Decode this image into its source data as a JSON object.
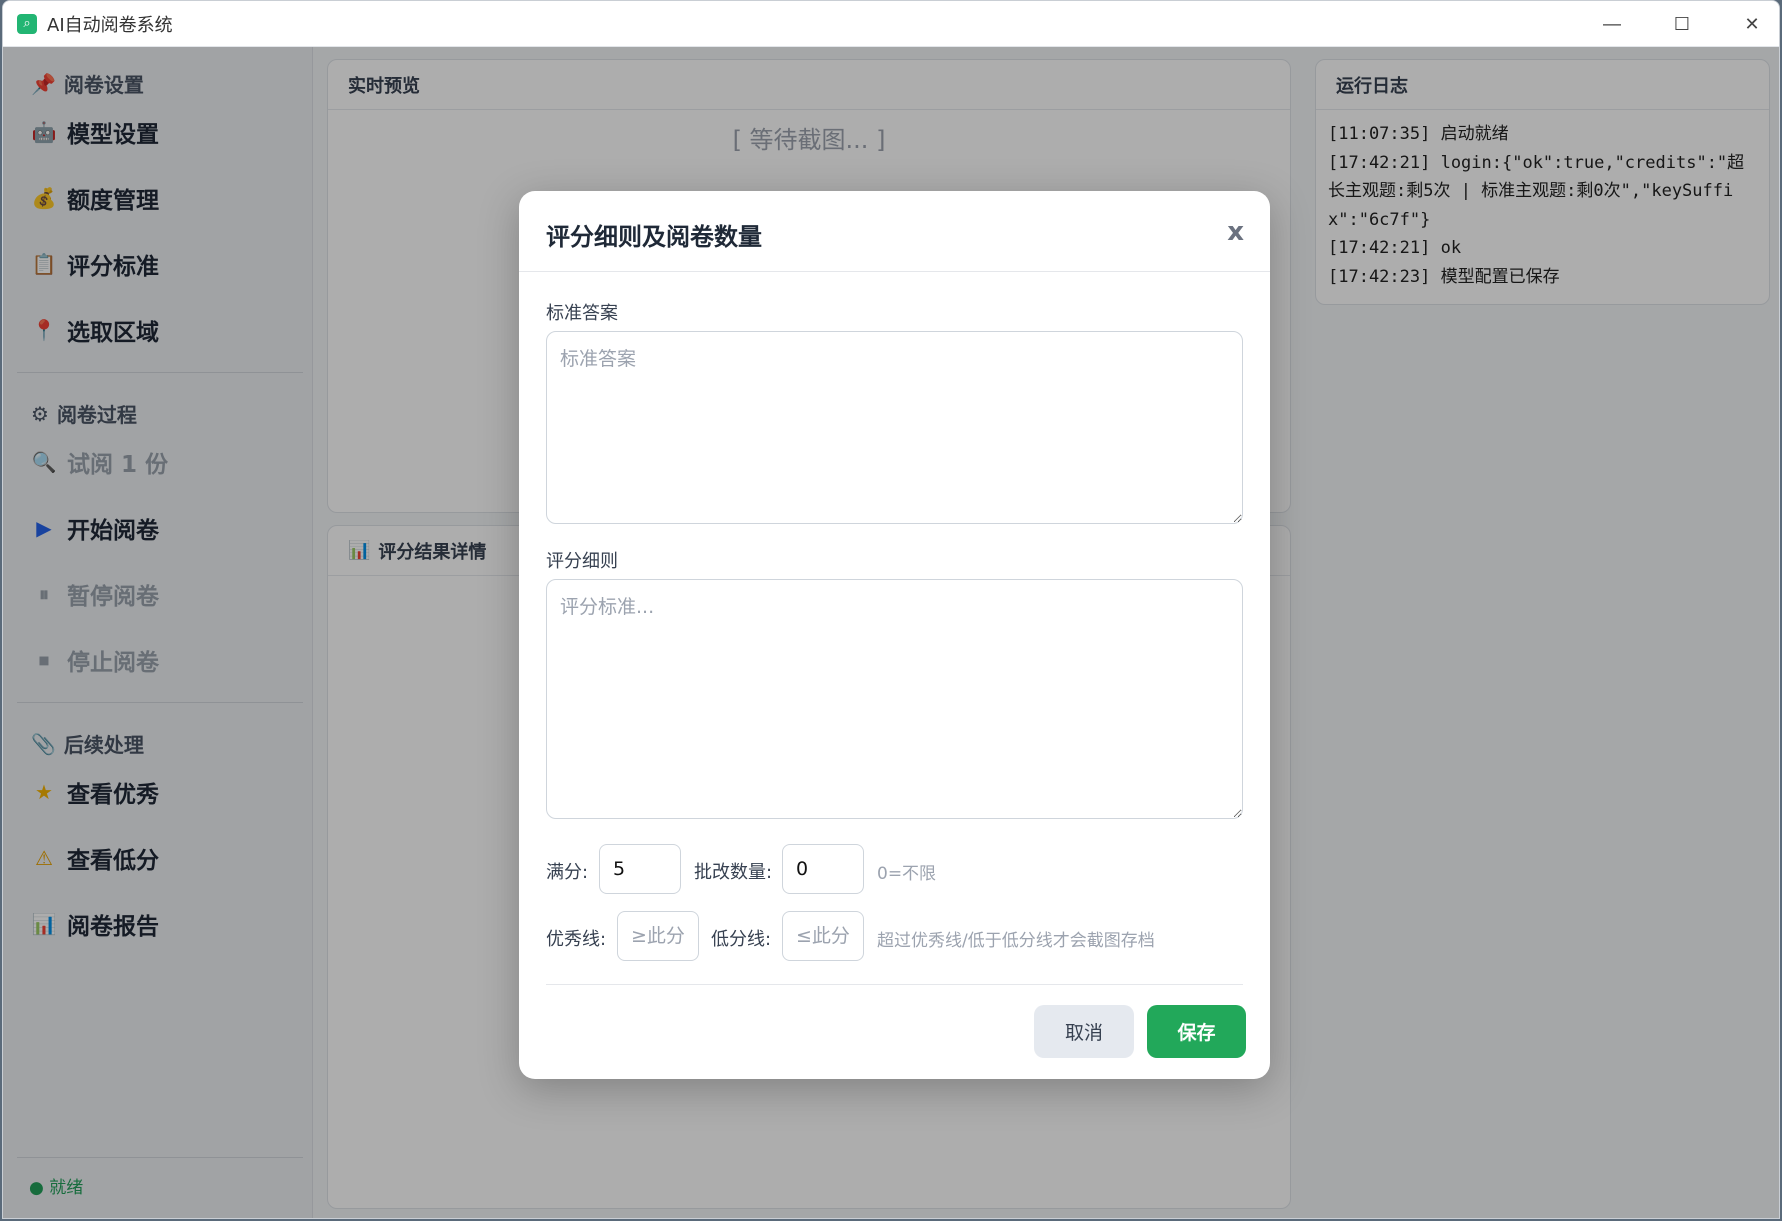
{
  "window": {
    "title": "AI自动阅卷系统",
    "app_icon": "magnify-icon"
  },
  "sidebar": {
    "sections": [
      {
        "title": "阅卷设置",
        "icon": "pin-icon",
        "items": [
          {
            "label": "模型设置",
            "icon": "robot-icon",
            "disabled": false
          },
          {
            "label": "额度管理",
            "icon": "money-bag-icon",
            "disabled": false
          },
          {
            "label": "评分标准",
            "icon": "clipboard-icon",
            "disabled": false
          },
          {
            "label": "选取区域",
            "icon": "location-pin-icon",
            "disabled": false
          }
        ]
      },
      {
        "title": "阅卷过程",
        "icon": "gear-icon",
        "items": [
          {
            "label": "试阅 1 份",
            "icon": "magnifier-icon",
            "disabled": true
          },
          {
            "label": "开始阅卷",
            "icon": "play-icon",
            "disabled": false
          },
          {
            "label": "暂停阅卷",
            "icon": "pause-icon",
            "disabled": true
          },
          {
            "label": "停止阅卷",
            "icon": "stop-icon",
            "disabled": true
          }
        ]
      },
      {
        "title": "后续处理",
        "icon": "paperclip-icon",
        "items": [
          {
            "label": "查看优秀",
            "icon": "star-icon",
            "disabled": false
          },
          {
            "label": "查看低分",
            "icon": "warning-icon",
            "disabled": false
          },
          {
            "label": "阅卷报告",
            "icon": "bar-chart-icon",
            "disabled": false
          }
        ]
      }
    ],
    "status": "● 就绪"
  },
  "preview": {
    "title": "实时预览",
    "waiting": "[ 等待截图... ]"
  },
  "results": {
    "title": "评分结果详情"
  },
  "log": {
    "title": "运行日志",
    "lines": [
      "[11:07:35] 启动就绪",
      "[17:42:21] login:{\"ok\":true,\"credits\":\"超长主观题:剩5次 | 标准主观题:剩0次\",\"keySuffix\":\"6c7f\"}",
      "[17:42:21] ok",
      "[17:42:23] 模型配置已保存"
    ]
  },
  "modal": {
    "title": "评分细则及阅卷数量",
    "close": "x",
    "answer_label": "标准答案",
    "answer_placeholder": "标准答案",
    "rubric_label": "评分细则",
    "rubric_placeholder": "评分标准...",
    "full_score_label": "满分:",
    "full_score_value": "5",
    "count_label": "批改数量:",
    "count_value": "0",
    "count_hint": "0=不限",
    "excellent_label": "优秀线:",
    "excellent_placeholder": "≥此分",
    "low_label": "低分线:",
    "low_placeholder": "≤此分",
    "threshold_hint": "超过优秀线/低于低分线才会截图存档",
    "cancel": "取消",
    "save": "保存"
  },
  "colors": {
    "primary": "#22a85a",
    "status": "#22a05a"
  }
}
